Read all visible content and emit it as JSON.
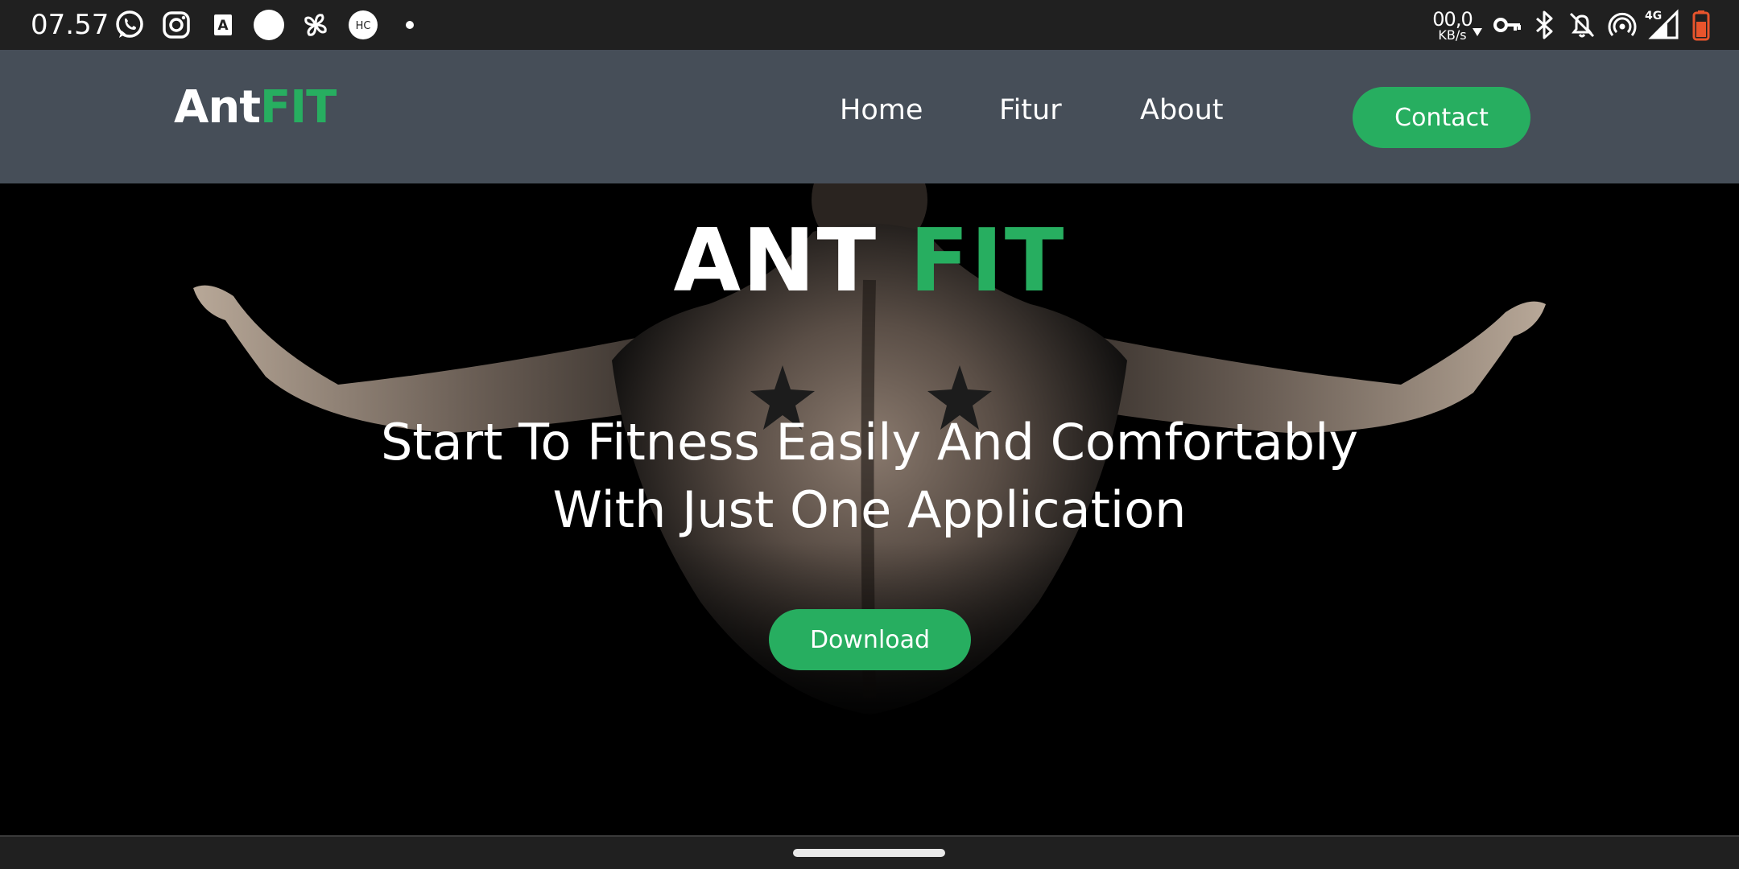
{
  "status_bar": {
    "time": "07.57",
    "net_speed_value": "00,0",
    "net_speed_unit": "KB/s",
    "network_type": "4G",
    "left_icons": [
      "whatsapp-icon",
      "instagram-icon",
      "a-notification-icon",
      "circle-notification-icon",
      "pinwheel-icon",
      "hc-app-icon",
      "more-dot-icon"
    ],
    "hc_label": "HC",
    "a_label": "A",
    "right_icons": [
      "vpn-key-icon",
      "bluetooth-icon",
      "notifications-off-icon",
      "hotspot-icon",
      "signal-icon",
      "battery-icon"
    ],
    "battery_color": "#e8542c"
  },
  "nav": {
    "logo_part1": "Ant",
    "logo_part2": "FIT",
    "links": [
      "Home",
      "Fitur",
      "About"
    ],
    "contact_label": "Contact"
  },
  "hero": {
    "title_part1": "ANT",
    "title_part2": "FIT",
    "subtitle_line1": "Start To Fitness Easily And Comfortably",
    "subtitle_line2": "With Just One Application",
    "download_label": "Download"
  },
  "colors": {
    "accent": "#27ae60",
    "navbar": "#464e58",
    "status_bar": "#202020",
    "hero_bg": "#000000"
  }
}
